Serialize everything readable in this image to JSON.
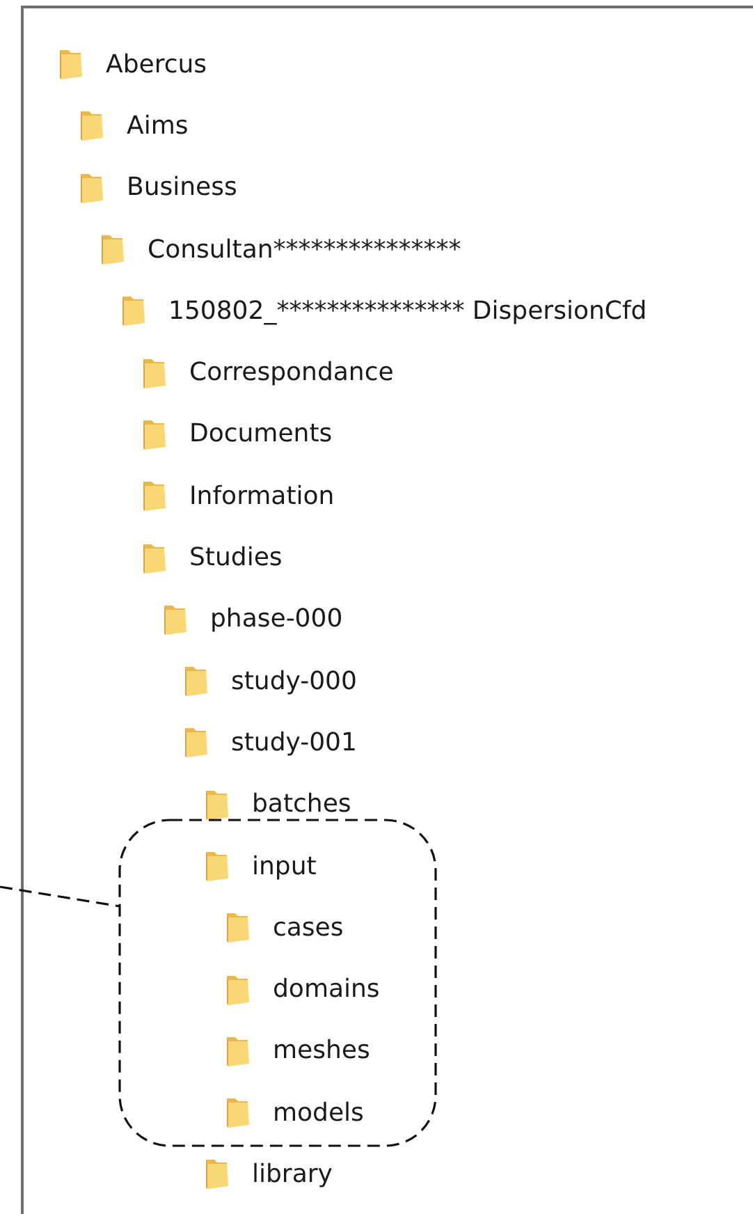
{
  "tree": [
    {
      "label": "Abercus",
      "children": [
        {
          "label": "Aims"
        },
        {
          "label": "Business",
          "children": [
            {
              "label": "Consultan***************",
              "children": [
                {
                  "label": "150802_*************** DispersionCfd",
                  "children": [
                    {
                      "label": "Correspondance"
                    },
                    {
                      "label": "Documents"
                    },
                    {
                      "label": "Information"
                    },
                    {
                      "label": "Studies",
                      "children": [
                        {
                          "label": "phase-000",
                          "children": [
                            {
                              "label": "study-000"
                            },
                            {
                              "label": "study-001",
                              "children": [
                                {
                                  "label": "batches"
                                },
                                {
                                  "label": "input",
                                  "children": [
                                    {
                                      "label": "cases"
                                    },
                                    {
                                      "label": "domains"
                                    },
                                    {
                                      "label": "meshes"
                                    },
                                    {
                                      "label": "models"
                                    }
                                  ]
                                },
                                {
                                  "label": "library"
                                }
                              ]
                            }
                          ]
                        }
                      ]
                    }
                  ]
                }
              ]
            }
          ]
        }
      ]
    }
  ]
}
